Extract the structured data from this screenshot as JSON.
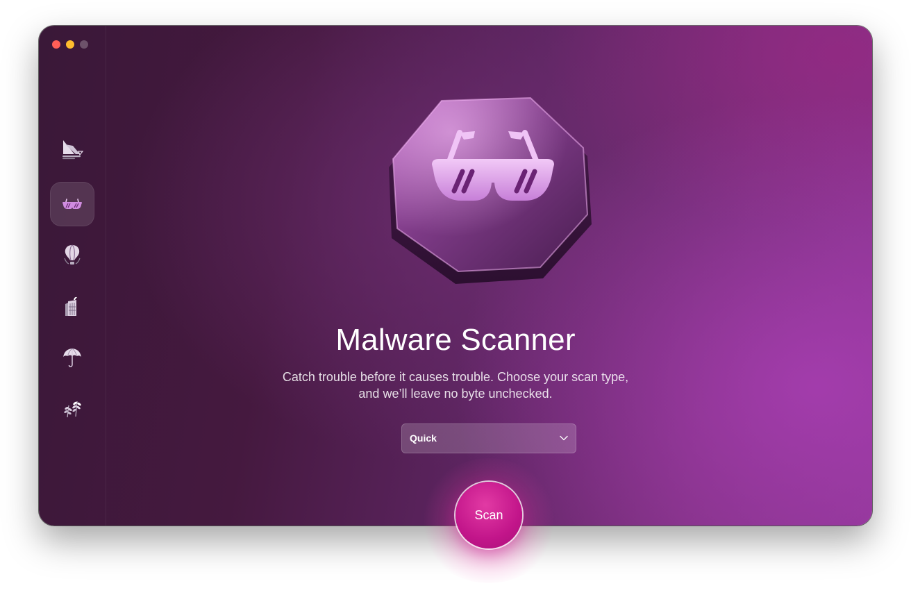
{
  "window": {
    "title": "Malware Scanner"
  },
  "sidebar": {
    "items": [
      {
        "name": "smart-care",
        "icon": "sailboat-icon",
        "active": false
      },
      {
        "name": "protection",
        "icon": "sunglasses-icon",
        "active": true
      },
      {
        "name": "performance",
        "icon": "hot-air-balloon-icon",
        "active": false
      },
      {
        "name": "applications",
        "icon": "building-icon",
        "active": false
      },
      {
        "name": "cleanup",
        "icon": "umbrella-icon",
        "active": false
      },
      {
        "name": "clutter",
        "icon": "plants-icon",
        "active": false
      }
    ]
  },
  "main": {
    "title": "Malware Scanner",
    "subtitle_line1": "Catch trouble before it causes trouble. Choose your scan type,",
    "subtitle_line2": "and we’ll leave no byte unchecked.",
    "scan_type": {
      "selected": "Quick"
    },
    "scan_button_label": "Scan"
  },
  "colors": {
    "accent": "#c2158a",
    "icon_tint": "#d9a0e6",
    "background_dark": "#3a1838",
    "background_light": "#8a3590"
  }
}
